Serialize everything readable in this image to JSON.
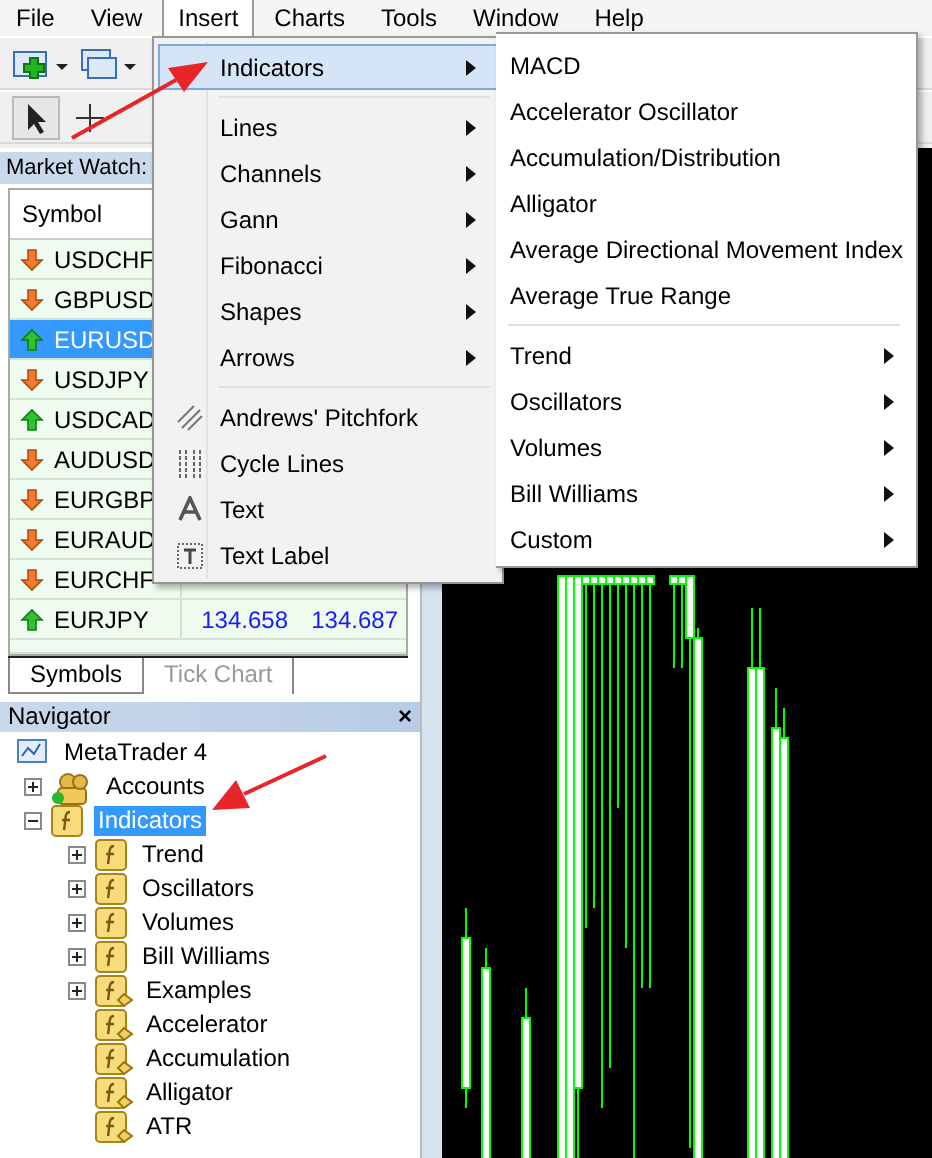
{
  "menu_bar": [
    {
      "label": "File",
      "selected": false
    },
    {
      "label": "View",
      "selected": false
    },
    {
      "label": "Insert",
      "selected": true
    },
    {
      "label": "Charts",
      "selected": false
    },
    {
      "label": "Tools",
      "selected": false
    },
    {
      "label": "Window",
      "selected": false
    },
    {
      "label": "Help",
      "selected": false
    }
  ],
  "insert_menu": {
    "groups": [
      [
        {
          "label": "Indicators",
          "has_submenu": true,
          "selected": true
        }
      ],
      [
        {
          "label": "Lines",
          "has_submenu": true,
          "selected": false
        },
        {
          "label": "Channels",
          "has_submenu": true,
          "selected": false
        },
        {
          "label": "Gann",
          "has_submenu": true,
          "selected": false
        },
        {
          "label": "Fibonacci",
          "has_submenu": true,
          "selected": false
        },
        {
          "label": "Shapes",
          "has_submenu": true,
          "selected": false
        },
        {
          "label": "Arrows",
          "has_submenu": true,
          "selected": false
        }
      ],
      [
        {
          "label": "Andrews' Pitchfork",
          "has_submenu": false,
          "selected": false
        },
        {
          "label": "Cycle Lines",
          "has_submenu": false,
          "selected": false
        },
        {
          "label": "Text",
          "has_submenu": false,
          "selected": false
        },
        {
          "label": "Text Label",
          "has_submenu": false,
          "selected": false
        }
      ]
    ]
  },
  "indicators_submenu": {
    "groups": [
      [
        {
          "label": "MACD",
          "has_submenu": false
        },
        {
          "label": "Accelerator Oscillator",
          "has_submenu": false
        },
        {
          "label": "Accumulation/Distribution",
          "has_submenu": false
        },
        {
          "label": "Alligator",
          "has_submenu": false
        },
        {
          "label": "Average Directional Movement Index",
          "has_submenu": false
        },
        {
          "label": "Average True Range",
          "has_submenu": false
        }
      ],
      [
        {
          "label": "Trend",
          "has_submenu": true
        },
        {
          "label": "Oscillators",
          "has_submenu": true
        },
        {
          "label": "Volumes",
          "has_submenu": true
        },
        {
          "label": "Bill Williams",
          "has_submenu": true
        },
        {
          "label": "Custom",
          "has_submenu": true
        }
      ]
    ]
  },
  "market_watch": {
    "title": "Market Watch:",
    "columns": [
      "Symbol"
    ],
    "rows": [
      {
        "symbol": "USDCHF",
        "kind": "down",
        "selected": false
      },
      {
        "symbol": "GBPUSD",
        "kind": "down",
        "selected": false
      },
      {
        "symbol": "EURUSD",
        "kind": "up",
        "selected": true
      },
      {
        "symbol": "USDJPY",
        "kind": "down",
        "selected": false
      },
      {
        "symbol": "USDCAD",
        "kind": "up",
        "selected": false
      },
      {
        "symbol": "AUDUSD",
        "kind": "down",
        "selected": false
      },
      {
        "symbol": "EURGBP",
        "kind": "down",
        "selected": false
      },
      {
        "symbol": "EURAUD",
        "kind": "down",
        "selected": false
      },
      {
        "symbol": "EURCHF",
        "kind": "down",
        "selected": false
      },
      {
        "symbol": "EURJPY",
        "kind": "up",
        "selected": false,
        "bid": "134.658",
        "ask": "134.687"
      }
    ],
    "tabs": [
      {
        "label": "Symbols",
        "selected": true
      },
      {
        "label": "Tick Chart",
        "selected": false
      }
    ]
  },
  "navigator": {
    "title": "Navigator",
    "close": "×",
    "tree": [
      {
        "label": "MetaTrader 4",
        "kind": "terminal",
        "selected": false,
        "children": [
          {
            "label": "Accounts",
            "kind": "accounts",
            "expanded": false,
            "selected": false
          },
          {
            "label": "Indicators",
            "kind": "folder",
            "expanded": true,
            "selected": true,
            "children": [
              {
                "label": "Trend",
                "kind": "folder",
                "expanded": false,
                "selected": false
              },
              {
                "label": "Oscillators",
                "kind": "folder",
                "expanded": false,
                "selected": false
              },
              {
                "label": "Volumes",
                "kind": "folder",
                "expanded": false,
                "selected": false
              },
              {
                "label": "Bill Williams",
                "kind": "folder",
                "expanded": false,
                "selected": false
              },
              {
                "label": "Examples",
                "kind": "indicator",
                "expanded": false,
                "selected": false
              },
              {
                "label": "Accelerator",
                "kind": "indicator",
                "selected": false
              },
              {
                "label": "Accumulation",
                "kind": "indicator",
                "selected": false
              },
              {
                "label": "Alligator",
                "kind": "indicator",
                "selected": false
              },
              {
                "label": "ATR",
                "kind": "indicator",
                "selected": false
              }
            ]
          }
        ]
      }
    ]
  }
}
